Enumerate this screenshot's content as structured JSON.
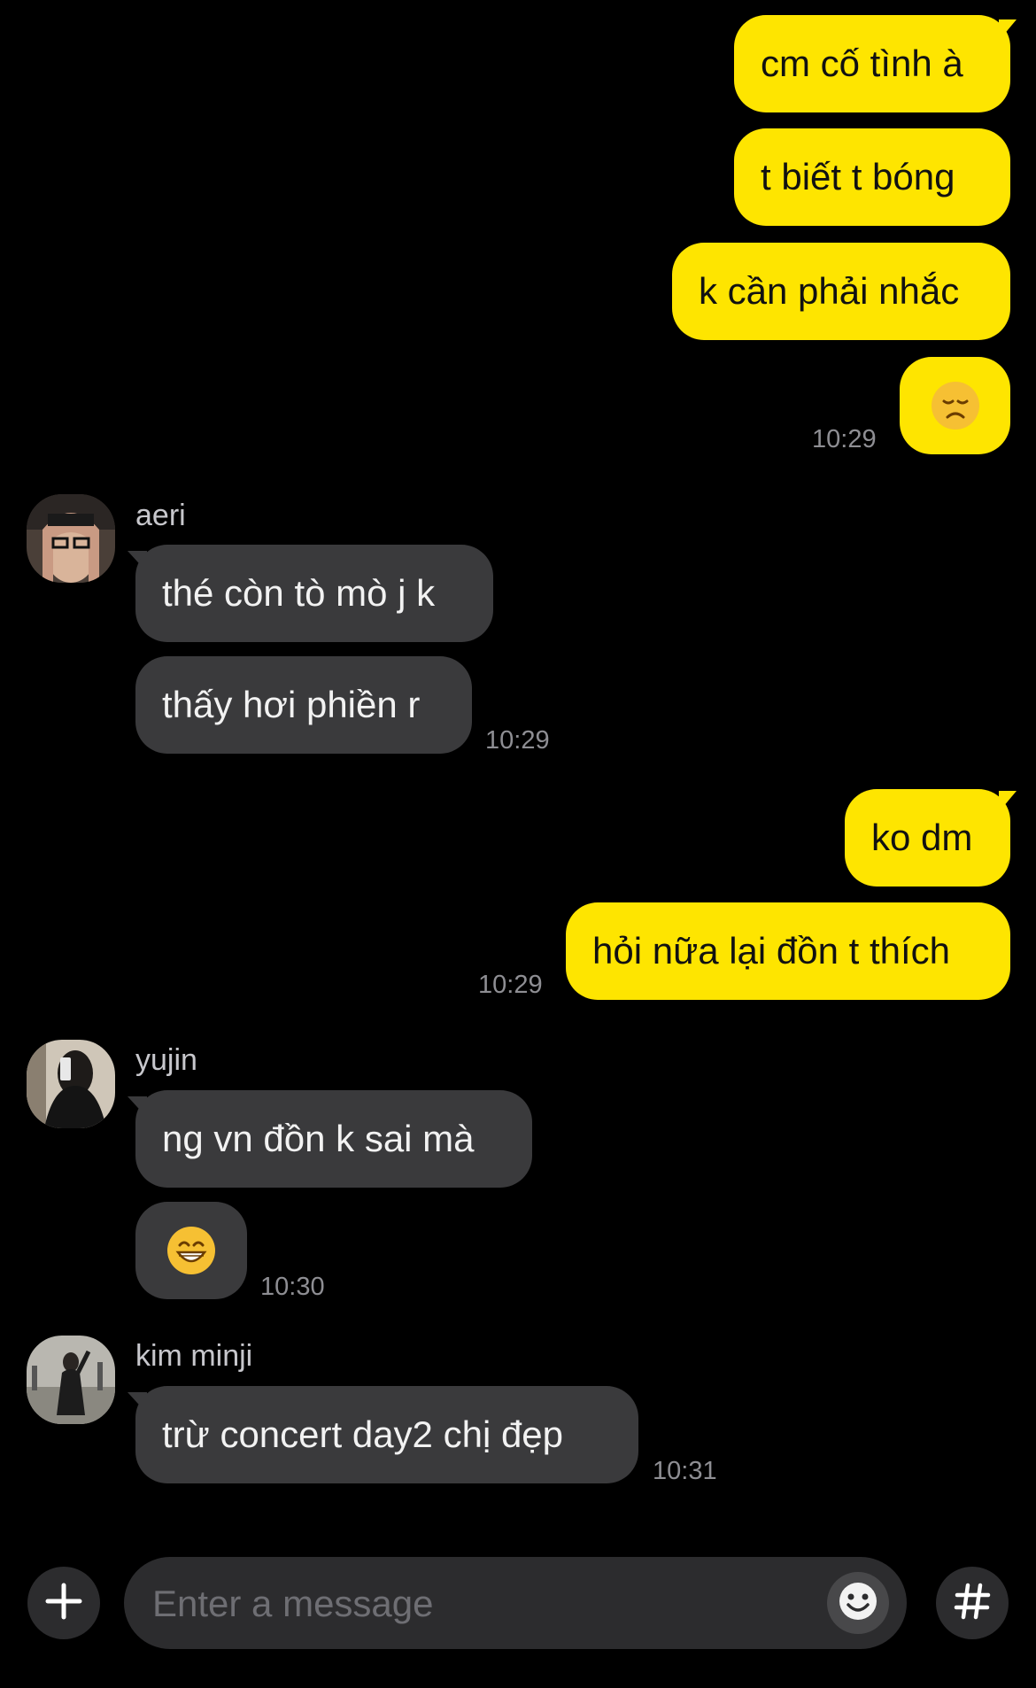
{
  "messages": {
    "m1": "cm cố tình à",
    "m2": "t biết t bóng",
    "m3": "k cần phải nhắc",
    "m4_emoji": "disappointed-face-emoji",
    "t1": "10:29",
    "aeri": {
      "name": "aeri",
      "m1": "thé còn tò mò j k",
      "m2": "thấy hơi phiền r",
      "time": "10:29"
    },
    "m5": "ko dm",
    "m6": "hỏi nữa lại đồn t thích",
    "t2": "10:29",
    "yujin": {
      "name": "yujin",
      "m1": "ng vn đồn k sai mà",
      "m2_emoji": "grinning-face-emoji",
      "time": "10:30"
    },
    "minji": {
      "name": "kim minji",
      "m1": "trừ concert day2 chị đẹp",
      "time": "10:31"
    }
  },
  "composer": {
    "placeholder": "Enter a message",
    "plus_icon": "plus-icon",
    "emoticon_icon": "emoticon-icon",
    "hash_icon": "hash-icon"
  },
  "colors": {
    "outgoing": "#FEE500",
    "incoming": "#3a3a3c",
    "background": "#000000"
  }
}
